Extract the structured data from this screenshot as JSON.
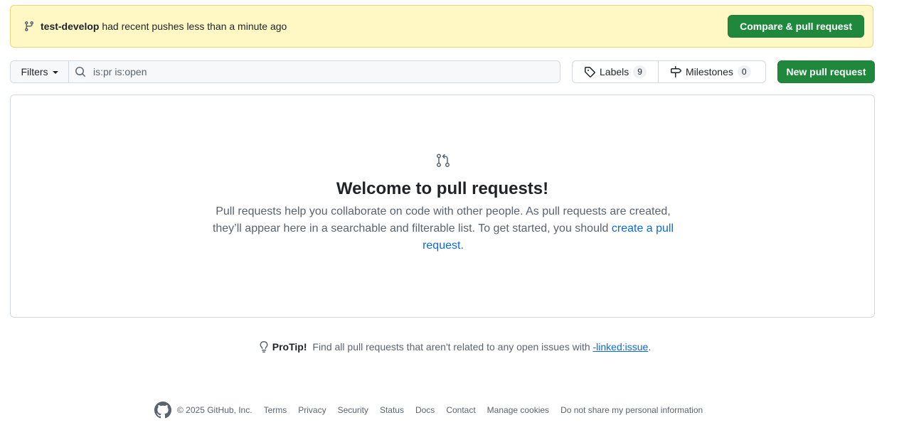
{
  "banner": {
    "branch": "test-develop",
    "message": " had recent pushes less than a minute ago",
    "compare_button": "Compare & pull request"
  },
  "toolbar": {
    "filters_label": "Filters",
    "search_value": "is:pr is:open",
    "labels_label": "Labels",
    "labels_count": "9",
    "milestones_label": "Milestones",
    "milestones_count": "0",
    "new_pr_button": "New pull request"
  },
  "blankslate": {
    "title": "Welcome to pull requests!",
    "description": "Pull requests help you collaborate on code with other people. As pull requests are created, they’ll appear here in a searchable and filterable list. To get started, you should ",
    "link_text": "create a pull request",
    "end": "."
  },
  "protip": {
    "label": "ProTip!",
    "text": " Find all pull requests that aren't related to any open issues with ",
    "link": "-linked:issue",
    "end": "."
  },
  "footer": {
    "copyright": "© 2025 GitHub, Inc.",
    "links": [
      "Terms",
      "Privacy",
      "Security",
      "Status",
      "Docs",
      "Contact",
      "Manage cookies",
      "Do not share my personal information"
    ]
  },
  "colors": {
    "accent_green": "#1f883d",
    "banner_bg": "#fff8c5",
    "link_blue": "#0969da"
  },
  "icons": {
    "banner": "git-branch-icon",
    "search": "search-icon",
    "labels": "tag-icon",
    "milestones": "milestone-icon",
    "blankslate": "git-pull-request-icon",
    "protip": "light-bulb-icon",
    "footer": "github-mark-icon"
  }
}
